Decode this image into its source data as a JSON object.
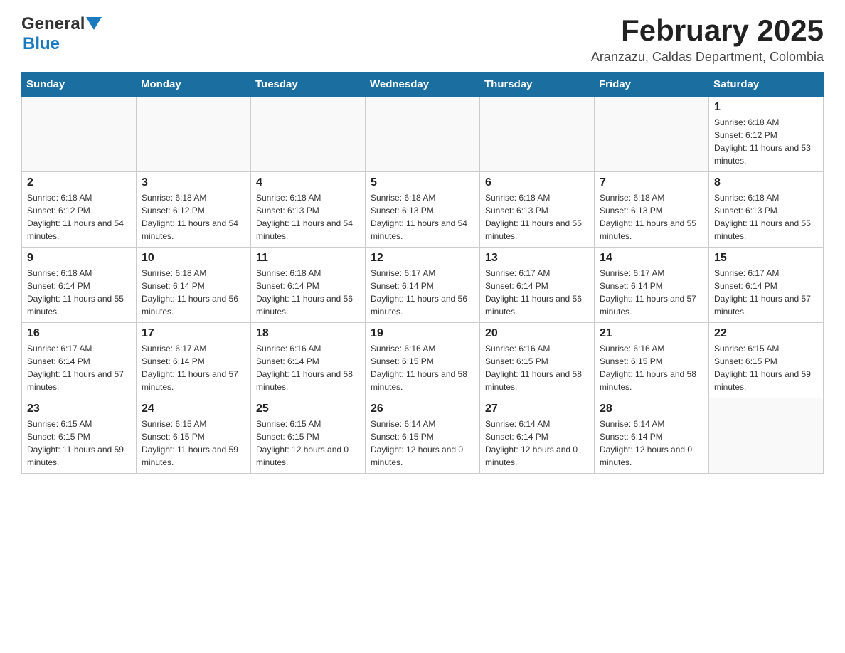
{
  "header": {
    "logo_general": "General",
    "logo_blue": "Blue",
    "title": "February 2025",
    "subtitle": "Aranzazu, Caldas Department, Colombia"
  },
  "days_of_week": [
    "Sunday",
    "Monday",
    "Tuesday",
    "Wednesday",
    "Thursday",
    "Friday",
    "Saturday"
  ],
  "weeks": [
    [
      {
        "day": "",
        "info": ""
      },
      {
        "day": "",
        "info": ""
      },
      {
        "day": "",
        "info": ""
      },
      {
        "day": "",
        "info": ""
      },
      {
        "day": "",
        "info": ""
      },
      {
        "day": "",
        "info": ""
      },
      {
        "day": "1",
        "info": "Sunrise: 6:18 AM\nSunset: 6:12 PM\nDaylight: 11 hours and 53 minutes."
      }
    ],
    [
      {
        "day": "2",
        "info": "Sunrise: 6:18 AM\nSunset: 6:12 PM\nDaylight: 11 hours and 54 minutes."
      },
      {
        "day": "3",
        "info": "Sunrise: 6:18 AM\nSunset: 6:12 PM\nDaylight: 11 hours and 54 minutes."
      },
      {
        "day": "4",
        "info": "Sunrise: 6:18 AM\nSunset: 6:13 PM\nDaylight: 11 hours and 54 minutes."
      },
      {
        "day": "5",
        "info": "Sunrise: 6:18 AM\nSunset: 6:13 PM\nDaylight: 11 hours and 54 minutes."
      },
      {
        "day": "6",
        "info": "Sunrise: 6:18 AM\nSunset: 6:13 PM\nDaylight: 11 hours and 55 minutes."
      },
      {
        "day": "7",
        "info": "Sunrise: 6:18 AM\nSunset: 6:13 PM\nDaylight: 11 hours and 55 minutes."
      },
      {
        "day": "8",
        "info": "Sunrise: 6:18 AM\nSunset: 6:13 PM\nDaylight: 11 hours and 55 minutes."
      }
    ],
    [
      {
        "day": "9",
        "info": "Sunrise: 6:18 AM\nSunset: 6:14 PM\nDaylight: 11 hours and 55 minutes."
      },
      {
        "day": "10",
        "info": "Sunrise: 6:18 AM\nSunset: 6:14 PM\nDaylight: 11 hours and 56 minutes."
      },
      {
        "day": "11",
        "info": "Sunrise: 6:18 AM\nSunset: 6:14 PM\nDaylight: 11 hours and 56 minutes."
      },
      {
        "day": "12",
        "info": "Sunrise: 6:17 AM\nSunset: 6:14 PM\nDaylight: 11 hours and 56 minutes."
      },
      {
        "day": "13",
        "info": "Sunrise: 6:17 AM\nSunset: 6:14 PM\nDaylight: 11 hours and 56 minutes."
      },
      {
        "day": "14",
        "info": "Sunrise: 6:17 AM\nSunset: 6:14 PM\nDaylight: 11 hours and 57 minutes."
      },
      {
        "day": "15",
        "info": "Sunrise: 6:17 AM\nSunset: 6:14 PM\nDaylight: 11 hours and 57 minutes."
      }
    ],
    [
      {
        "day": "16",
        "info": "Sunrise: 6:17 AM\nSunset: 6:14 PM\nDaylight: 11 hours and 57 minutes."
      },
      {
        "day": "17",
        "info": "Sunrise: 6:17 AM\nSunset: 6:14 PM\nDaylight: 11 hours and 57 minutes."
      },
      {
        "day": "18",
        "info": "Sunrise: 6:16 AM\nSunset: 6:14 PM\nDaylight: 11 hours and 58 minutes."
      },
      {
        "day": "19",
        "info": "Sunrise: 6:16 AM\nSunset: 6:15 PM\nDaylight: 11 hours and 58 minutes."
      },
      {
        "day": "20",
        "info": "Sunrise: 6:16 AM\nSunset: 6:15 PM\nDaylight: 11 hours and 58 minutes."
      },
      {
        "day": "21",
        "info": "Sunrise: 6:16 AM\nSunset: 6:15 PM\nDaylight: 11 hours and 58 minutes."
      },
      {
        "day": "22",
        "info": "Sunrise: 6:15 AM\nSunset: 6:15 PM\nDaylight: 11 hours and 59 minutes."
      }
    ],
    [
      {
        "day": "23",
        "info": "Sunrise: 6:15 AM\nSunset: 6:15 PM\nDaylight: 11 hours and 59 minutes."
      },
      {
        "day": "24",
        "info": "Sunrise: 6:15 AM\nSunset: 6:15 PM\nDaylight: 11 hours and 59 minutes."
      },
      {
        "day": "25",
        "info": "Sunrise: 6:15 AM\nSunset: 6:15 PM\nDaylight: 12 hours and 0 minutes."
      },
      {
        "day": "26",
        "info": "Sunrise: 6:14 AM\nSunset: 6:15 PM\nDaylight: 12 hours and 0 minutes."
      },
      {
        "day": "27",
        "info": "Sunrise: 6:14 AM\nSunset: 6:14 PM\nDaylight: 12 hours and 0 minutes."
      },
      {
        "day": "28",
        "info": "Sunrise: 6:14 AM\nSunset: 6:14 PM\nDaylight: 12 hours and 0 minutes."
      },
      {
        "day": "",
        "info": ""
      }
    ]
  ]
}
